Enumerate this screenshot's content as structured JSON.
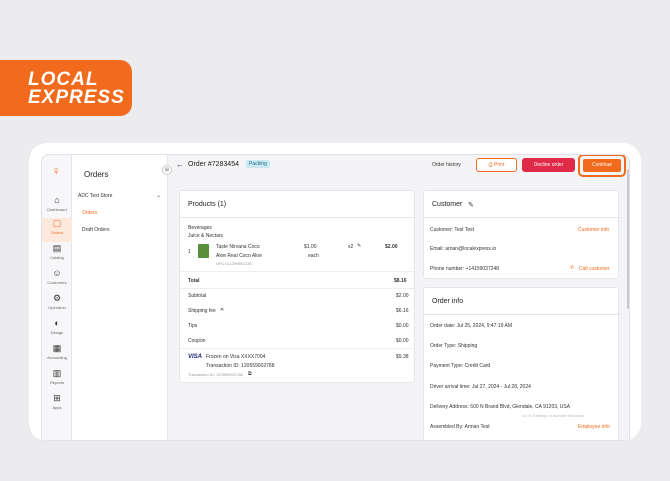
{
  "brand": {
    "line1": "LOCAL",
    "line2": "EXPRESS",
    "accent": "#f26a1b"
  },
  "rail": [
    {
      "label": "Dashboard",
      "icon": "home-icon"
    },
    {
      "label": "Orders",
      "icon": "orders-icon",
      "active": true
    },
    {
      "label": "Catalog",
      "icon": "catalog-icon"
    },
    {
      "label": "Customers",
      "icon": "customers-icon"
    },
    {
      "label": "Operation",
      "icon": "operation-icon"
    },
    {
      "label": "Design",
      "icon": "design-icon"
    },
    {
      "label": "Accounting",
      "icon": "accounting-icon"
    },
    {
      "label": "Reports",
      "icon": "reports-icon"
    },
    {
      "label": "Apps",
      "icon": "apps-icon"
    }
  ],
  "subnav": {
    "title": "Orders",
    "store": "ADC Test Store",
    "items": [
      "Orders",
      "Draft Orders"
    ]
  },
  "header": {
    "order_title": "Order #7283454",
    "status_badge": "Packing",
    "order_history": "Order history",
    "print": "Print",
    "decline": "Decline order",
    "continue": "Continue"
  },
  "products": {
    "title": "Products (1)",
    "category": "Beverages",
    "subcategory": "Juice & Nectars",
    "item": {
      "index": "1",
      "name_line1": "Taste Nirvana Coco",
      "name_line2": "Aloe Real Coco Aloe",
      "upc": "UPC 011299801135",
      "price": "$1.00",
      "unit": "each",
      "qty": "x2",
      "total": "$2.00"
    },
    "total_label": "Total",
    "total_value": "$8.16",
    "rows": [
      {
        "label": "Subtotal",
        "value": "$2.00"
      },
      {
        "label": "Shipping fee",
        "value": "$6.16"
      },
      {
        "label": "Tips",
        "value": "$0.00"
      },
      {
        "label": "Coupon",
        "value": "$0.00"
      }
    ],
    "payment": {
      "card": "VISA",
      "line1": "Frozen on Visa XXXX7004",
      "line2": "Transaction ID: 120559002788",
      "small": "Transaction ID: 120559002788",
      "amount": "$9.38"
    }
  },
  "customer": {
    "title": "Customer",
    "name": "Customer: Test Test",
    "info_link": "Customer info",
    "email": "Email: arnan@localexpress.io",
    "phone": "Phone number: +14159037248",
    "call": "Call customer"
  },
  "order_info": {
    "title": "Order info",
    "date": "Order date: Jul 25, 2024, 9:47:19 AM",
    "type": "Order Type: Shipping",
    "payment": "Payment Type: Credit Card",
    "arrival": "Driver arrival time: Jul 27, 2024 - Jul 28, 2024",
    "address": "Delivery Address: 600 N Brand Blvd, Glendale, CA 91203, USA",
    "assembled": "Assembled By: Arman Test",
    "employee_link": "Employee info",
    "watermark": "Go to Settings to activate Windows."
  }
}
